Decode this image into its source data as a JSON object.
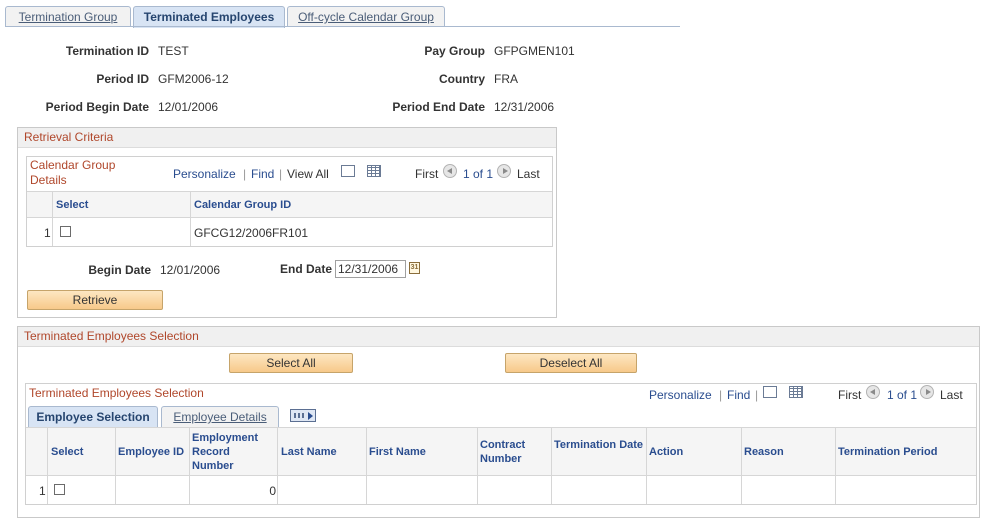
{
  "tabs": [
    {
      "label": "Termination Group",
      "active": false
    },
    {
      "label": "Terminated Employees",
      "active": true
    },
    {
      "label": "Off-cycle Calendar Group",
      "active": false
    }
  ],
  "header": {
    "termination_id_label": "Termination ID",
    "termination_id": "TEST",
    "pay_group_label": "Pay Group",
    "pay_group": "GFPGMEN101",
    "period_id_label": "Period ID",
    "period_id": "GFM2006-12",
    "country_label": "Country",
    "country": "FRA",
    "period_begin_label": "Period Begin Date",
    "period_begin": "12/01/2006",
    "period_end_label": "Period End Date",
    "period_end": "12/31/2006"
  },
  "retrieval": {
    "title": "Retrieval Criteria",
    "grid_title": "Calendar Group Details",
    "personalize": "Personalize",
    "find": "Find",
    "view_all": "View All",
    "first": "First",
    "count": "1 of 1",
    "last": "Last",
    "col_select": "Select",
    "col_calendar_group_id": "Calendar Group ID",
    "rows": [
      {
        "num": "1",
        "calendar_group_id": "GFCG12/2006FR101"
      }
    ],
    "begin_date_label": "Begin Date",
    "begin_date": "12/01/2006",
    "end_date_label": "End Date",
    "end_date": "12/31/2006",
    "retrieve_button": "Retrieve"
  },
  "terminated": {
    "title": "Terminated Employees Selection",
    "select_all": "Select All",
    "deselect_all": "Deselect All",
    "grid_title": "Terminated Employees Selection",
    "personalize": "Personalize",
    "find": "Find",
    "first": "First",
    "count": "1 of 1",
    "last": "Last",
    "subtabs": [
      "Employee Selection",
      "Employee Details"
    ],
    "columns": {
      "select": "Select",
      "employee_id": "Employee ID",
      "employment_record": "Employment Record Number",
      "last_name": "Last Name",
      "first_name": "First Name",
      "contract_number": "Contract Number",
      "termination_date": "Termination Date",
      "action": "Action",
      "reason": "Reason",
      "termination_period": "Termination Period"
    },
    "rows": [
      {
        "num": "1",
        "employment_record": "0"
      }
    ]
  }
}
